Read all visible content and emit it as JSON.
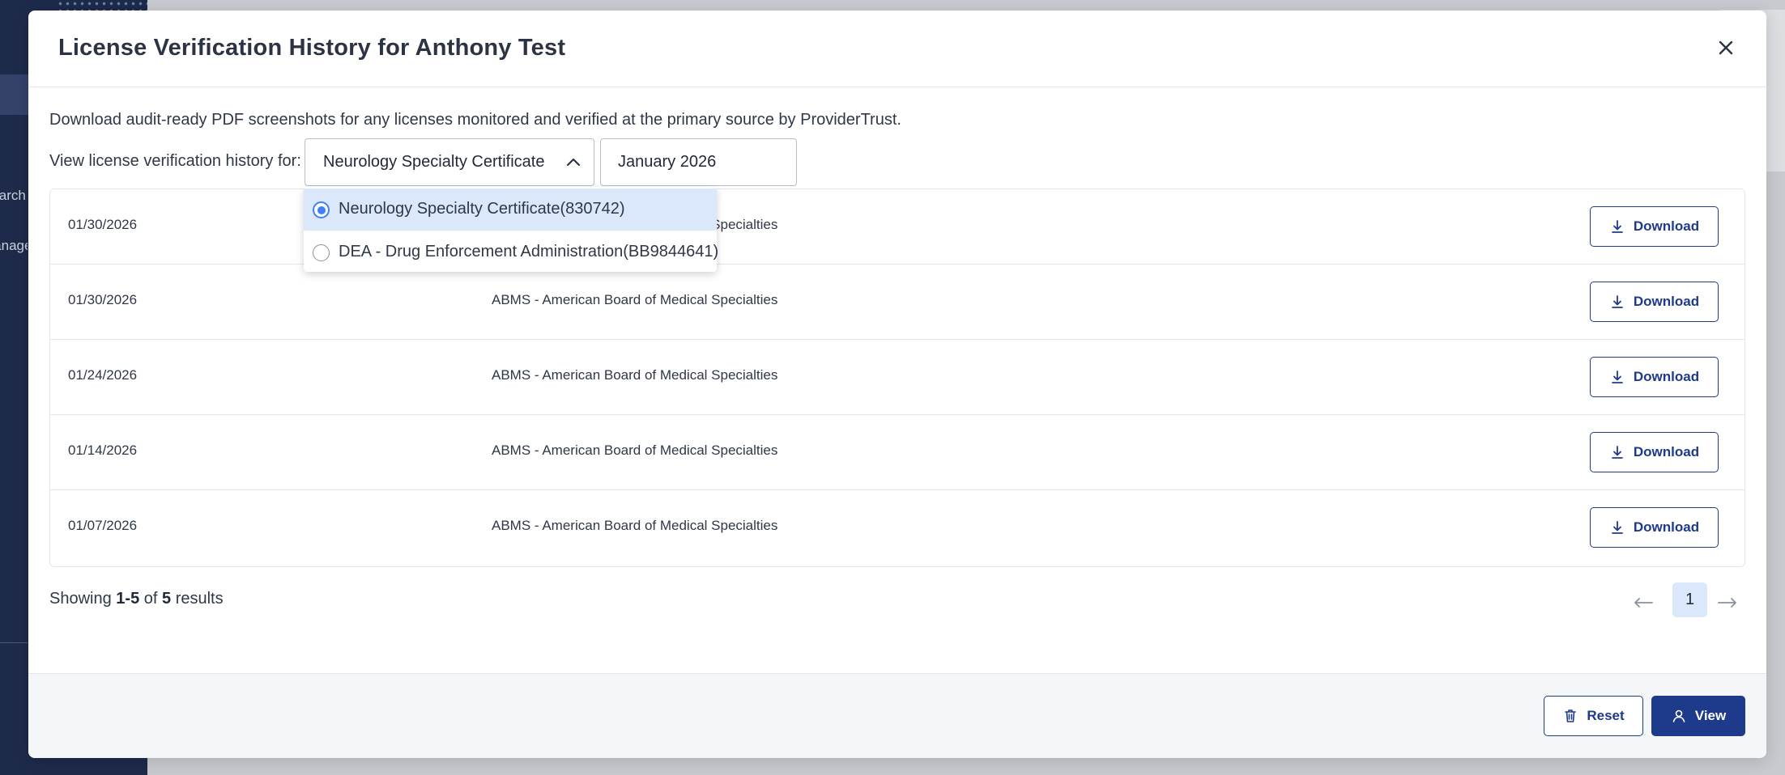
{
  "background": {
    "sidebar_items": [
      "Search",
      "Management"
    ]
  },
  "modal": {
    "title": "License Verification History for Anthony Test",
    "close_icon": "close-icon"
  },
  "intro_text": "Download audit-ready PDF screenshots for any licenses monitored and verified at the primary source by ProviderTrust.",
  "filter": {
    "label": "View license verification history for:",
    "license_selected": "Neurology Specialty Certificate",
    "month_selected": "January 2026",
    "options": [
      {
        "label": "Neurology Specialty Certificate(830742)",
        "selected": true
      },
      {
        "label": "DEA - Drug Enforcement Administration(BB9844641)",
        "selected": false
      }
    ]
  },
  "table": {
    "rows": [
      {
        "date": "01/30/2026",
        "source": "ABMS - American Board of Medical Specialties",
        "action": "Download"
      },
      {
        "date": "01/30/2026",
        "source": "ABMS - American Board of Medical Specialties",
        "action": "Download"
      },
      {
        "date": "01/24/2026",
        "source": "ABMS - American Board of Medical Specialties",
        "action": "Download"
      },
      {
        "date": "01/14/2026",
        "source": "ABMS - American Board of Medical Specialties",
        "action": "Download"
      },
      {
        "date": "01/07/2026",
        "source": "ABMS - American Board of Medical Specialties",
        "action": "Download"
      }
    ]
  },
  "pagination": {
    "showing_prefix": "Showing",
    "range": "1-5",
    "of_word": "of",
    "total": "5",
    "results_word": "results",
    "current_page": "1"
  },
  "footer": {
    "reset_label": "Reset",
    "view_label": "View"
  },
  "colors": {
    "primary": "#1e3a8a",
    "selected_bg": "#dbe7fb",
    "radio_accent": "#3b82f6",
    "sidebar": "#1e2a4a"
  }
}
